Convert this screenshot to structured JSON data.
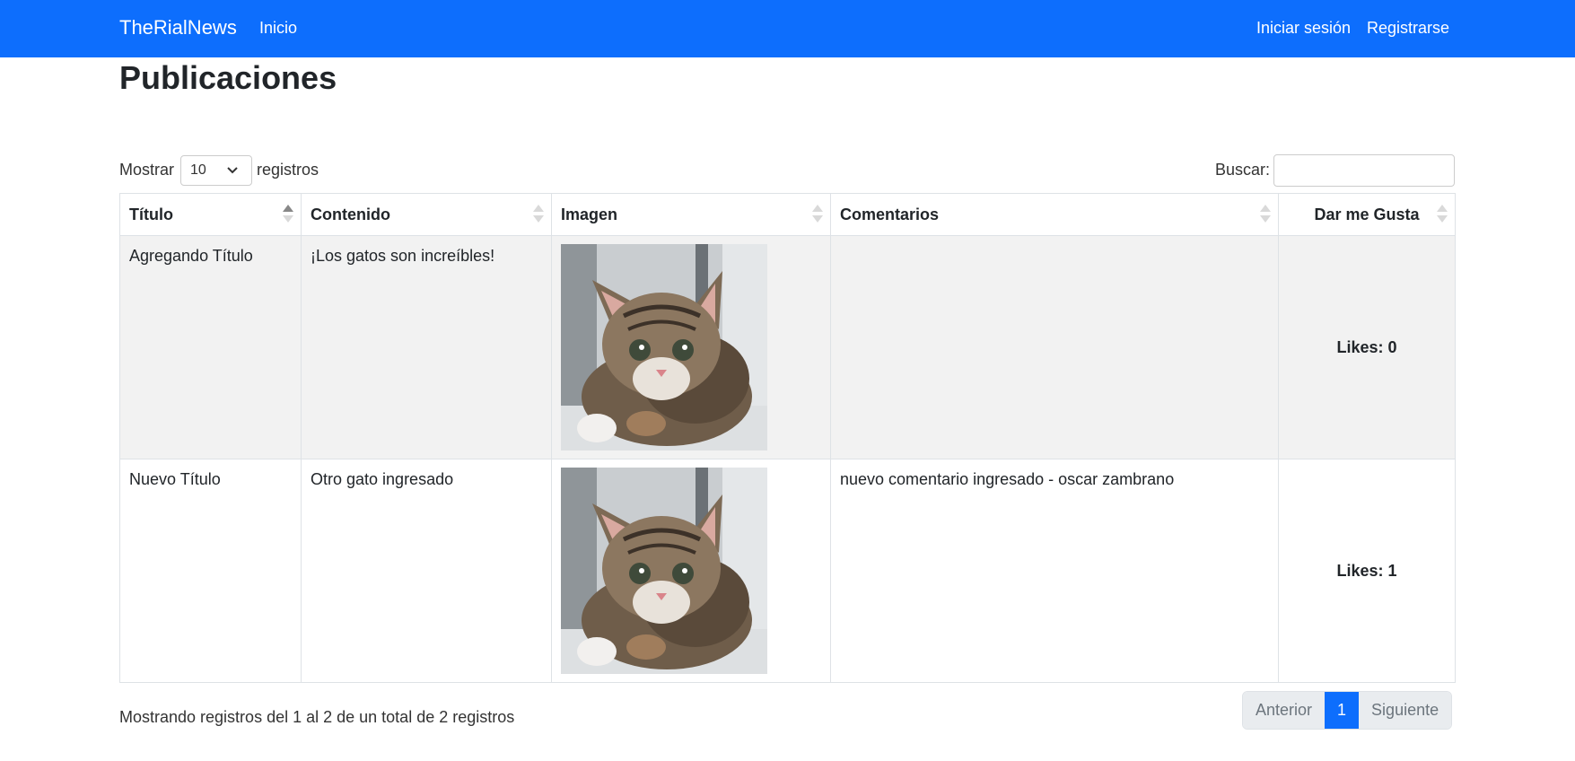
{
  "navbar": {
    "brand": "TheRialNews",
    "links": [
      "Inicio"
    ],
    "right_links": [
      "Iniciar sesión",
      "Registrarse"
    ],
    "color": "#0d6efd"
  },
  "page": {
    "title": "Publicaciones"
  },
  "controls": {
    "length_prefix": "Mostrar",
    "length_value": "10",
    "length_suffix": "registros",
    "search_label": "Buscar:",
    "search_value": ""
  },
  "table": {
    "columns": [
      "Título",
      "Contenido",
      "Imagen",
      "Comentarios",
      "Dar me Gusta"
    ],
    "sorted_column": "Título",
    "rows": [
      {
        "titulo": "Agregando Título",
        "contenido": "¡Los gatos son increíbles!",
        "imagen": "kitten-photo",
        "comentarios": "",
        "likes": "Likes: 0"
      },
      {
        "titulo": "Nuevo Título",
        "contenido": "Otro gato ingresado",
        "imagen": "kitten-photo",
        "comentarios": "nuevo comentario ingresado - oscar zambrano",
        "likes": "Likes: 1"
      }
    ]
  },
  "footer": {
    "info": "Mostrando registros del 1 al 2 de un total de 2 registros",
    "pagination": {
      "previous": "Anterior",
      "current": "1",
      "next": "Siguiente"
    }
  }
}
